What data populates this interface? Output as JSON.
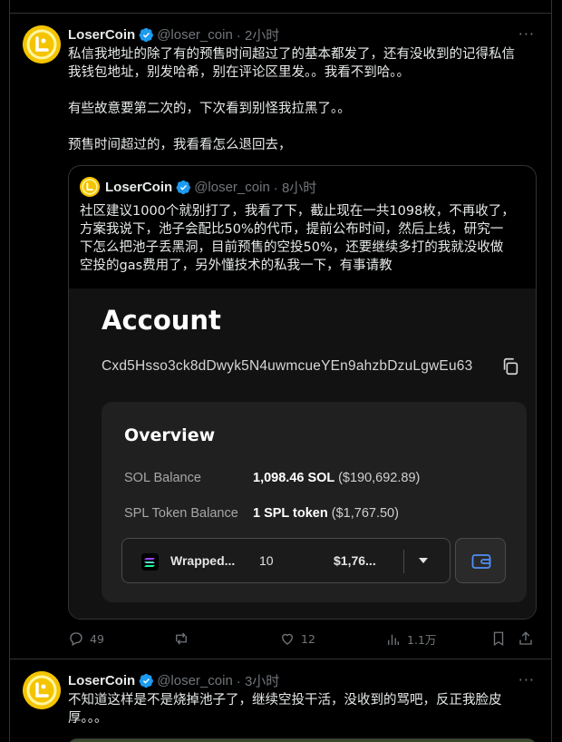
{
  "posts": [
    {
      "author": "LoserCoin",
      "handle": "@loser_coin",
      "time": "· 2小时",
      "more": "···",
      "text": "私信我地址的除了有的预售时间超过了的基本都发了，还有没收到的记得私信\n我钱包地址，别发哈希，别在评论区里发。。我看不到哈。。\n\n有些故意要第二次的，下次看到别怪我拉黑了。。\n\n预售时间超过的，我看看怎么退回去，",
      "quote": {
        "author": "LoserCoin",
        "handle": "@loser_coin",
        "time": "· 8小时",
        "text": "社区建议1000个就别打了，我看了下，截止现在一共1098枚，不再收了，\n方案我说下，池子会配比50%的代币，提前公布时间，然后上线，研究一\n下怎么把池子丢黑洞，目前预售的空投50%，还要继续多打的我就没收做\n空投的gas费用了，另外懂技术的私我一下，有事请教",
        "screenshot": {
          "title": "Account",
          "address": "Cxd5Hsso3ck8dDwyk5N4uwmcueYEn9ahzbDzuLgwEu63",
          "overview_title": "Overview",
          "sol_label": "SOL Balance",
          "sol_value": "1,098.46 SOL",
          "sol_usd": "($190,692.89)",
          "spl_label": "SPL Token Balance",
          "spl_value": "1 SPL token",
          "spl_usd": "($1,767.50)",
          "token_name": "Wrapped...",
          "token_qty": "10",
          "token_usd": "$1,76..."
        }
      },
      "stats": {
        "replies": "49",
        "retweets": "",
        "likes": "12",
        "views": "1.1万"
      }
    },
    {
      "author": "LoserCoin",
      "handle": "@loser_coin",
      "time": "· 3小时",
      "more": "···",
      "text": "不知道这样是不是烧掉池子了，继续空投干活，没收到的骂吧，反正我脸皮\n厚。。。"
    }
  ],
  "colors": {
    "accent": "#1d9bf0",
    "gold": "#f4c400",
    "muted": "#71767b",
    "border": "#2f3336"
  },
  "icons": [
    "verified-badge-icon",
    "more-icon",
    "copy-icon",
    "wallet-icon",
    "reply-icon",
    "retweet-icon",
    "like-icon",
    "views-icon",
    "bookmark-icon",
    "share-icon",
    "caret-down-icon"
  ]
}
